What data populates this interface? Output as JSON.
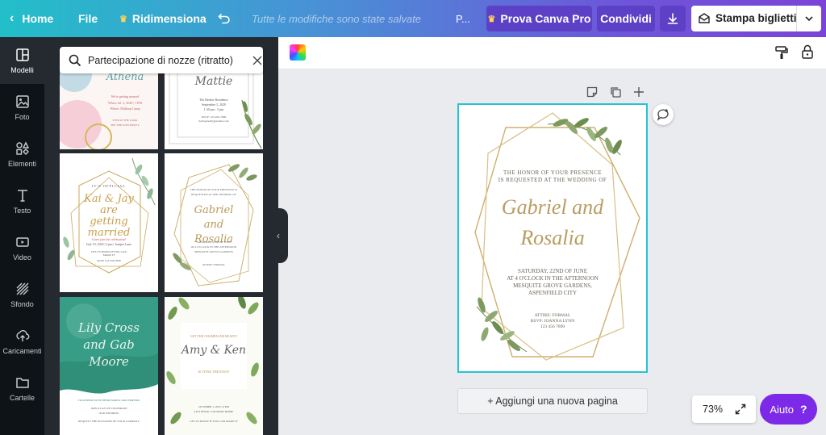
{
  "topbar": {
    "home_label": "Home",
    "file_label": "File",
    "resize_label": "Ridimensiona",
    "saved_status": "Tutte le modifiche sono state salvate",
    "title_truncated": "P...",
    "pro_label": "Prova Canva Pro",
    "share_label": "Condividi",
    "print_label": "Stampa biglietti"
  },
  "rail": {
    "items": [
      {
        "label": "Modelli",
        "icon": "templates-icon"
      },
      {
        "label": "Foto",
        "icon": "photo-icon"
      },
      {
        "label": "Elementi",
        "icon": "elements-icon"
      },
      {
        "label": "Testo",
        "icon": "text-icon"
      },
      {
        "label": "Video",
        "icon": "video-icon"
      },
      {
        "label": "Sfondo",
        "icon": "background-icon"
      },
      {
        "label": "Caricamenti",
        "icon": "upload-icon"
      },
      {
        "label": "Cartelle",
        "icon": "folder-icon"
      }
    ]
  },
  "search": {
    "value": "Partecipazione di nozze (ritratto)"
  },
  "templates": [
    {
      "name": "Athena",
      "line1": "We're getting married",
      "line2": "When: Jul. 3, 2020 | 1 PM",
      "line3": "Where: Mulloop Camp",
      "line4": "STEP AT THE LOOK",
      "line5": "SEE THE UNIVERSITY"
    },
    {
      "name": "Mattie",
      "line1": "The Beeker Residence",
      "line2": "September 3, 2020",
      "line3": "1:30 pm - 5 pm",
      "line4": "RSVP: 123-456-7890",
      "line5": "hello@reallygreatsite.com"
    },
    {
      "top": "IT'S OFFICIAL",
      "name": "Kai & Jay are getting married",
      "line1": "Come join the celebration!",
      "line2": "July 19, 2025 | 5 pm | Juniper Lane",
      "line3": "LET US KNOW IF YOU CAN MAKE IT",
      "line4": "RSVP 123-456-7890"
    },
    {
      "top": "THE HONOR OF YOUR PRESENCE IS REQUESTED AT THE WEDDING OF",
      "name": "Gabriel and Rosalia",
      "line1": "SATURDAY, 22ND OF JUNE",
      "line2": "AT 4 O'CLOCK IN THE AFTERNOON",
      "line3": "MESQUITE GROVE GARDENS",
      "line4": "ATTIRE: FORMAL"
    },
    {
      "name": "Lily Cross and Gab Moore",
      "line1": "TOGETHER WITH THEIR FAMILY AND FRIENDS",
      "line2": "JOIN US AS WE CELEBRATE",
      "line3": "OUR WEDDING",
      "line4": "REQUEST THE PLEASURE OF YOUR COMPANY"
    },
    {
      "top": "GET THE CHAMPAGNE READY!",
      "name": "Amy & Ken",
      "line1": "IS TYING THE KNOT!",
      "line2": "OCTOBER 1, 2025 | 6 PM",
      "line3": "LILY PEDAL COUNTRY HOME",
      "line4": "LET US KNOW IF YOU CAN MAKE IT"
    }
  ],
  "invitation": {
    "intro1": "THE HONOR OF YOUR PRESENCE",
    "intro2": "IS REQUESTED AT THE WEDDING OF",
    "name1": "Gabriel and",
    "name2": "Rosalia",
    "d1": "SATURDAY, 22ND OF JUNE",
    "d2": "AT 4 O'CLOCK IN THE AFTERNOON",
    "d3": "MESQUITE GROVE GARDENS,",
    "d4": "ASPENFIELD CITY",
    "r1": "ATTIRE: FORMAL",
    "r2": "RSVP: JOANNA LYNN",
    "r3": "123 456 7890"
  },
  "editor": {
    "add_page_label": "+ Aggiungi una nuova pagina",
    "zoom": "73%",
    "help_label": "Aiuto",
    "help_glyph": "?"
  },
  "colors": {
    "accent": "#7d2ae8",
    "gold": "#c8aa6e",
    "selection": "#27c2d6"
  }
}
